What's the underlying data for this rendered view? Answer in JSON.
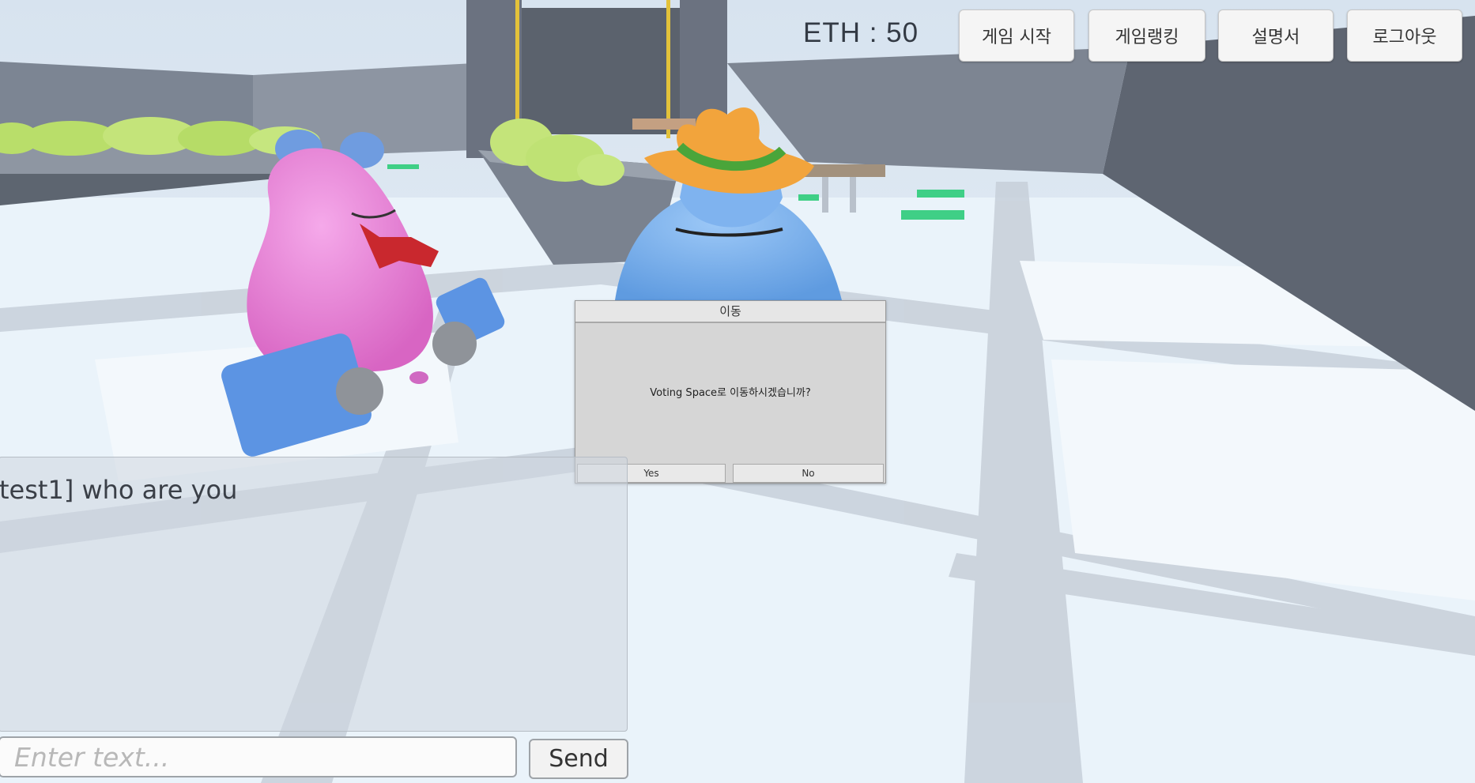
{
  "hud": {
    "eth_label": "ETH : 50",
    "buttons": [
      {
        "label": "게임 시작"
      },
      {
        "label": "게임랭킹"
      },
      {
        "label": "설명서"
      },
      {
        "label": "로그아웃"
      }
    ]
  },
  "dialog": {
    "title": "이동",
    "message": "Voting Space로 이동하시겠습니까?",
    "yes_label": "Yes",
    "no_label": "No"
  },
  "chat": {
    "messages": [
      {
        "text": "test1] who are you"
      }
    ],
    "input_placeholder": "Enter text...",
    "input_value": "",
    "send_label": "Send"
  },
  "colors": {
    "pink_character": "#e87fd6",
    "blue_character": "#6fa9ea",
    "hat": "#f0a33d",
    "floor": "#eaf3fa",
    "walls": "#737c89"
  }
}
